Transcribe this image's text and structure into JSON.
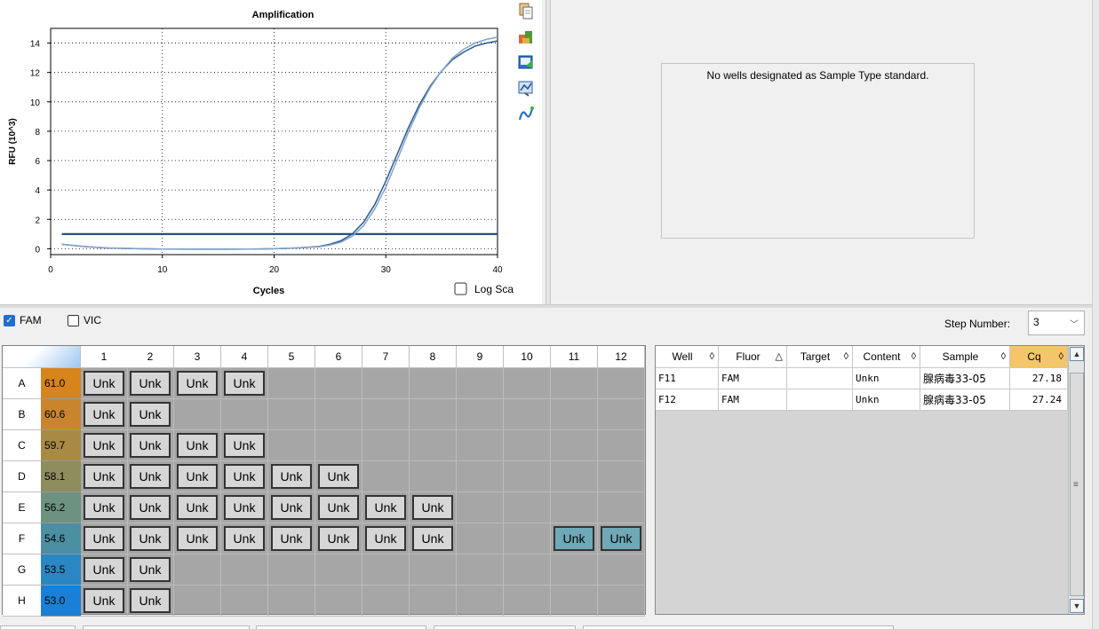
{
  "chart": {
    "title": "Amplification",
    "xlabel": "Cycles",
    "ylabel": "RFU (10^3)",
    "log_scale_label": "Log Scale",
    "log_scale_checked": false
  },
  "chart_data": {
    "type": "line",
    "title": "Amplification",
    "xlabel": "Cycles",
    "ylabel": "RFU (10^3)",
    "xlim": [
      0,
      40
    ],
    "ylim": [
      -0.4,
      15
    ],
    "xticks": [
      0,
      10,
      20,
      30,
      40
    ],
    "yticks": [
      0,
      2,
      4,
      6,
      8,
      10,
      12,
      14
    ],
    "grid": true,
    "threshold": 1.0,
    "series": [
      {
        "color": "#2b5a8c",
        "x": [
          1,
          3,
          5,
          8,
          10,
          13,
          15,
          18,
          20,
          22,
          24,
          25,
          26,
          27,
          28,
          29,
          30,
          31,
          32,
          33,
          34,
          35,
          36,
          37,
          38,
          39,
          40
        ],
        "y": [
          0.3,
          0.15,
          0.05,
          0.0,
          -0.02,
          -0.03,
          -0.03,
          -0.02,
          0.0,
          0.05,
          0.15,
          0.3,
          0.55,
          1.0,
          1.8,
          3.0,
          4.6,
          6.4,
          8.2,
          9.8,
          11.1,
          12.1,
          12.9,
          13.4,
          13.8,
          14.0,
          14.15
        ]
      },
      {
        "color": "#7fa3c9",
        "x": [
          1,
          3,
          5,
          8,
          10,
          13,
          15,
          18,
          20,
          22,
          24,
          25,
          26,
          27,
          28,
          29,
          30,
          31,
          32,
          33,
          34,
          35,
          36,
          37,
          38,
          39,
          40
        ],
        "y": [
          0.3,
          0.15,
          0.05,
          0.0,
          -0.02,
          -0.03,
          -0.03,
          -0.02,
          0.0,
          0.05,
          0.13,
          0.25,
          0.45,
          0.85,
          1.55,
          2.7,
          4.2,
          6.0,
          7.9,
          9.6,
          11.0,
          12.1,
          13.0,
          13.6,
          14.0,
          14.25,
          14.4
        ]
      }
    ]
  },
  "standard_curve": {
    "message": "No wells designated as Sample Type standard."
  },
  "fluors": [
    {
      "label": "FAM",
      "checked": true
    },
    {
      "label": "VIC",
      "checked": false
    }
  ],
  "step": {
    "label": "Step Number:",
    "value": "3"
  },
  "plate": {
    "columns": [
      "1",
      "2",
      "3",
      "4",
      "5",
      "6",
      "7",
      "8",
      "9",
      "10",
      "11",
      "12"
    ],
    "rows": [
      {
        "label": "A",
        "temp": "61.0",
        "color": "#d8841c",
        "wells": [
          "Unk",
          "Unk",
          "Unk",
          "Unk",
          "",
          "",
          "",
          "",
          "",
          "",
          "",
          ""
        ]
      },
      {
        "label": "B",
        "temp": "60.6",
        "color": "#c9852e",
        "wells": [
          "Unk",
          "Unk",
          "",
          "",
          "",
          "",
          "",
          "",
          "",
          "",
          "",
          ""
        ]
      },
      {
        "label": "C",
        "temp": "59.7",
        "color": "#a98a45",
        "wells": [
          "Unk",
          "Unk",
          "Unk",
          "Unk",
          "",
          "",
          "",
          "",
          "",
          "",
          "",
          ""
        ]
      },
      {
        "label": "D",
        "temp": "58.1",
        "color": "#8d8d5e",
        "wells": [
          "Unk",
          "Unk",
          "Unk",
          "Unk",
          "Unk",
          "Unk",
          "",
          "",
          "",
          "",
          "",
          ""
        ]
      },
      {
        "label": "E",
        "temp": "56.2",
        "color": "#6c9280",
        "wells": [
          "Unk",
          "Unk",
          "Unk",
          "Unk",
          "Unk",
          "Unk",
          "Unk",
          "Unk",
          "",
          "",
          "",
          ""
        ]
      },
      {
        "label": "F",
        "temp": "54.6",
        "color": "#4c8ea2",
        "wells": [
          "Unk",
          "Unk",
          "Unk",
          "Unk",
          "Unk",
          "Unk",
          "Unk",
          "Unk",
          "",
          "",
          "Unk",
          "Unk"
        ]
      },
      {
        "label": "G",
        "temp": "53.5",
        "color": "#2a87c4",
        "wells": [
          "Unk",
          "Unk",
          "",
          "",
          "",
          "",
          "",
          "",
          "",
          "",
          "",
          ""
        ]
      },
      {
        "label": "H",
        "temp": "53.0",
        "color": "#1a7fd6",
        "wells": [
          "Unk",
          "Unk",
          "",
          "",
          "",
          "",
          "",
          "",
          "",
          "",
          "",
          ""
        ]
      }
    ],
    "selected_wells": [
      "F11",
      "F12"
    ]
  },
  "results": {
    "headers": [
      "Well",
      "Fluor",
      "Target",
      "Content",
      "Sample",
      "Cq"
    ],
    "sort_marks": [
      "◊",
      "△",
      "◊",
      "◊",
      "◊",
      "◊"
    ],
    "rows": [
      {
        "well": "F11",
        "fluor": "FAM",
        "target": "",
        "content": "Unkn",
        "sample": "腺病毒33-05",
        "cq": "27.18"
      },
      {
        "well": "F12",
        "fluor": "FAM",
        "target": "",
        "content": "Unkn",
        "sample": "腺病毒33-05",
        "cq": "27.24"
      }
    ]
  },
  "icons": [
    "copy-icon",
    "export-icon",
    "save-image-icon",
    "chart-settings-icon",
    "curve-tool-icon"
  ]
}
